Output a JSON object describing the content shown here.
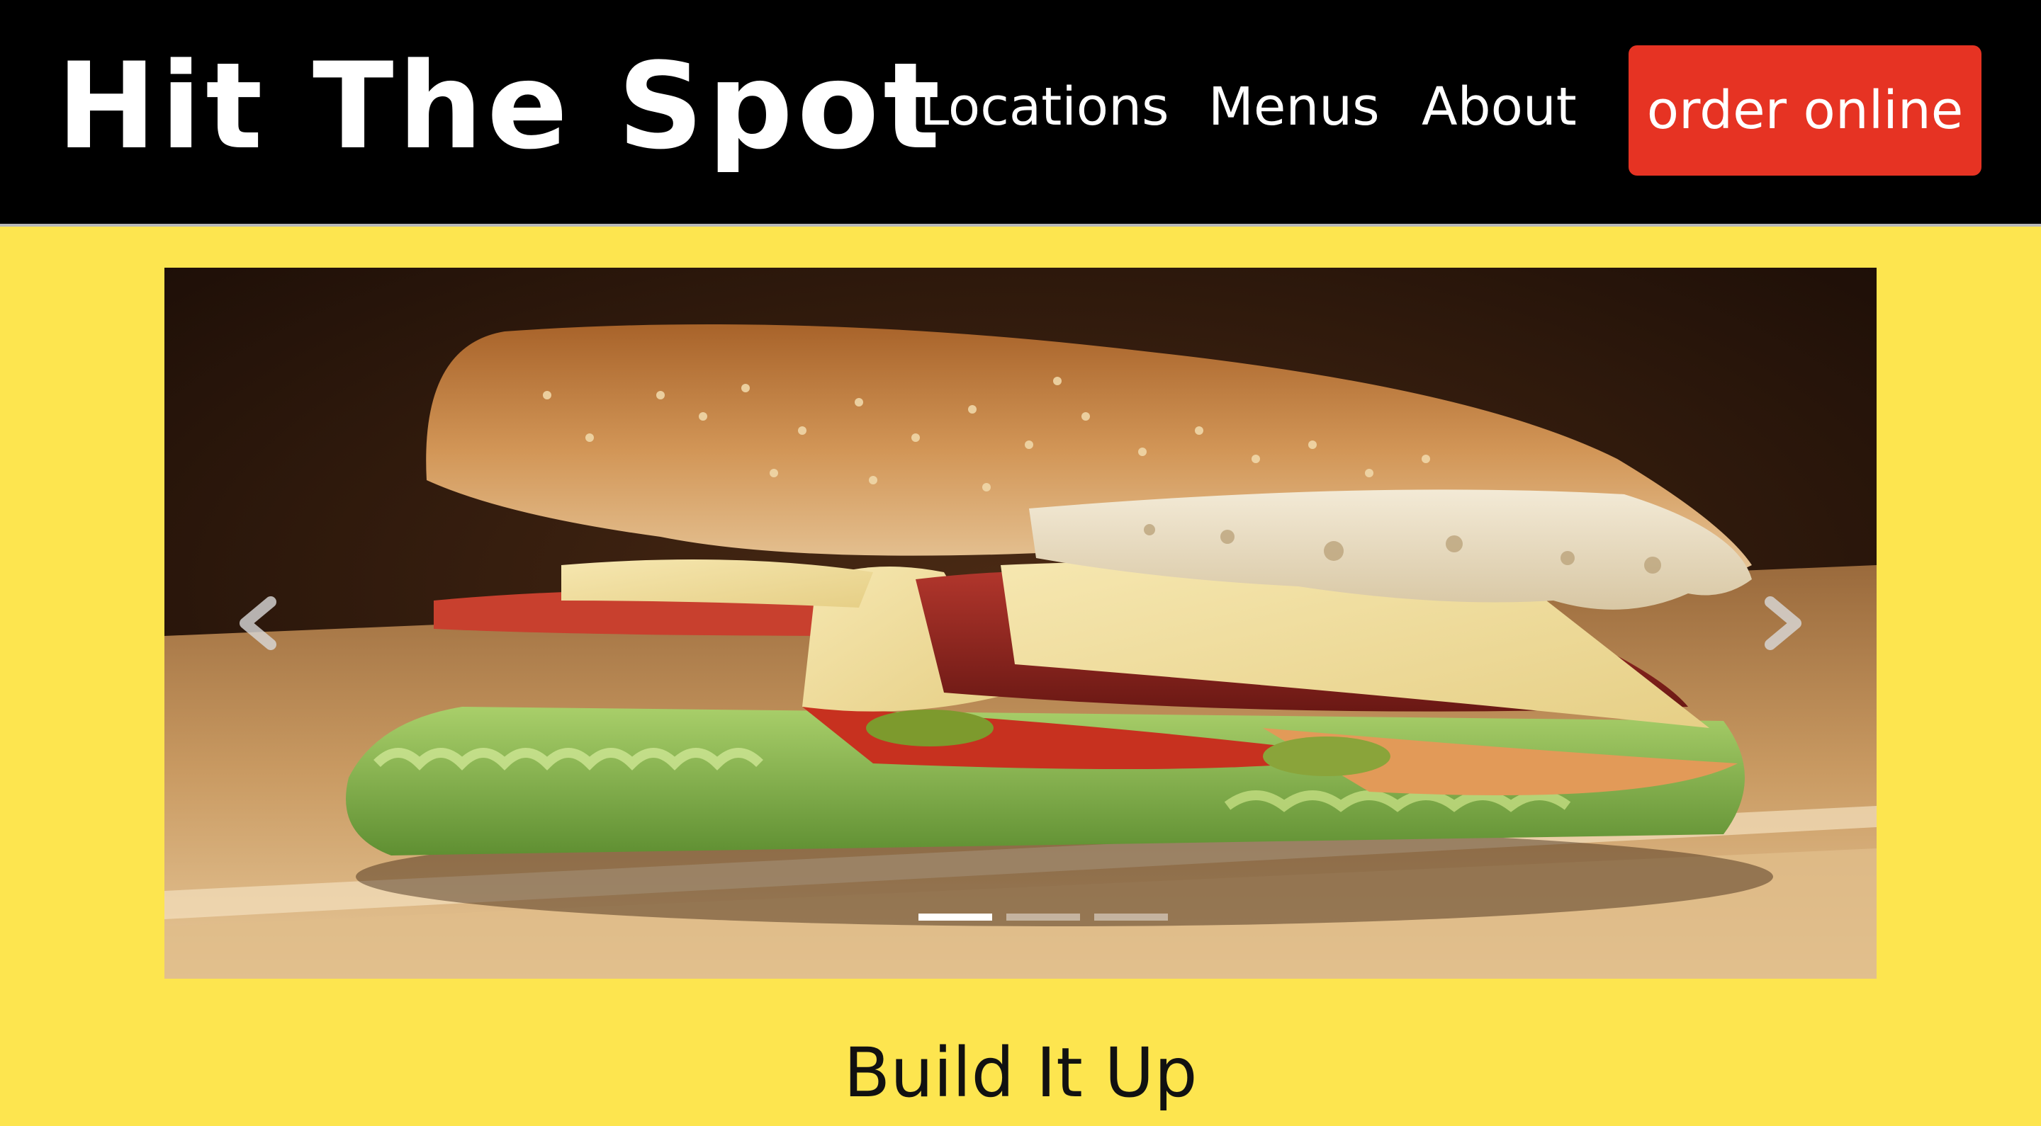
{
  "header": {
    "brand": "Hit The Spot",
    "nav": {
      "locations": "Locations",
      "menus": "Menus",
      "about": "About"
    },
    "order_button": "order online"
  },
  "carousel": {
    "slides": [
      {
        "image": "sandwich-photo",
        "active": true
      },
      {
        "image": "slide-2",
        "active": false
      },
      {
        "image": "slide-3",
        "active": false
      }
    ],
    "prev_icon": "chevron-left-icon",
    "next_icon": "chevron-right-icon"
  },
  "main": {
    "section_title": "Build It Up"
  },
  "colors": {
    "header_bg": "#000000",
    "page_bg": "#fde54f",
    "order_button_bg": "#e63323"
  }
}
